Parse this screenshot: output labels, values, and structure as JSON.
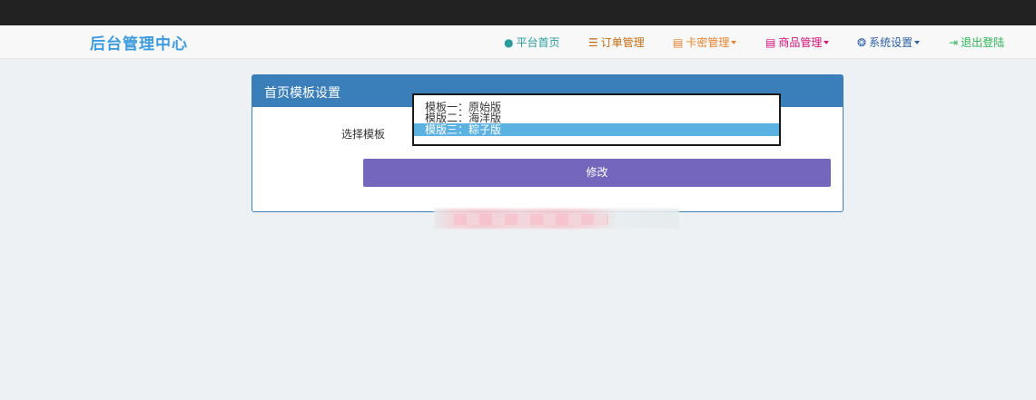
{
  "navbar": {
    "brand": "后台管理中心",
    "items": [
      {
        "label": "平台首页",
        "icon": "user-icon",
        "glyph": "👤",
        "color": "#2a9c9b",
        "dropdown": false
      },
      {
        "label": "订单管理",
        "icon": "list-icon",
        "glyph": "☰",
        "color": "#c56b12",
        "dropdown": false
      },
      {
        "label": "卡密管理",
        "icon": "book-icon",
        "glyph": "▤",
        "color": "#e8842d",
        "dropdown": true
      },
      {
        "label": "商品管理",
        "icon": "book-icon",
        "glyph": "▤",
        "color": "#d8127a",
        "dropdown": true
      },
      {
        "label": "系统设置",
        "icon": "gear-icon",
        "glyph": "✲",
        "color": "#2a5fa8",
        "dropdown": true
      },
      {
        "label": "退出登陆",
        "icon": "logout-icon",
        "glyph": "⇥",
        "color": "#29b854",
        "dropdown": false
      }
    ]
  },
  "panel": {
    "title": "首页模板设置",
    "field_label": "选择模板",
    "options": [
      "模板一：原始版",
      "模版二：海洋版",
      "模版三：粽子版"
    ],
    "selected_index": 2,
    "submit_label": "修改"
  }
}
